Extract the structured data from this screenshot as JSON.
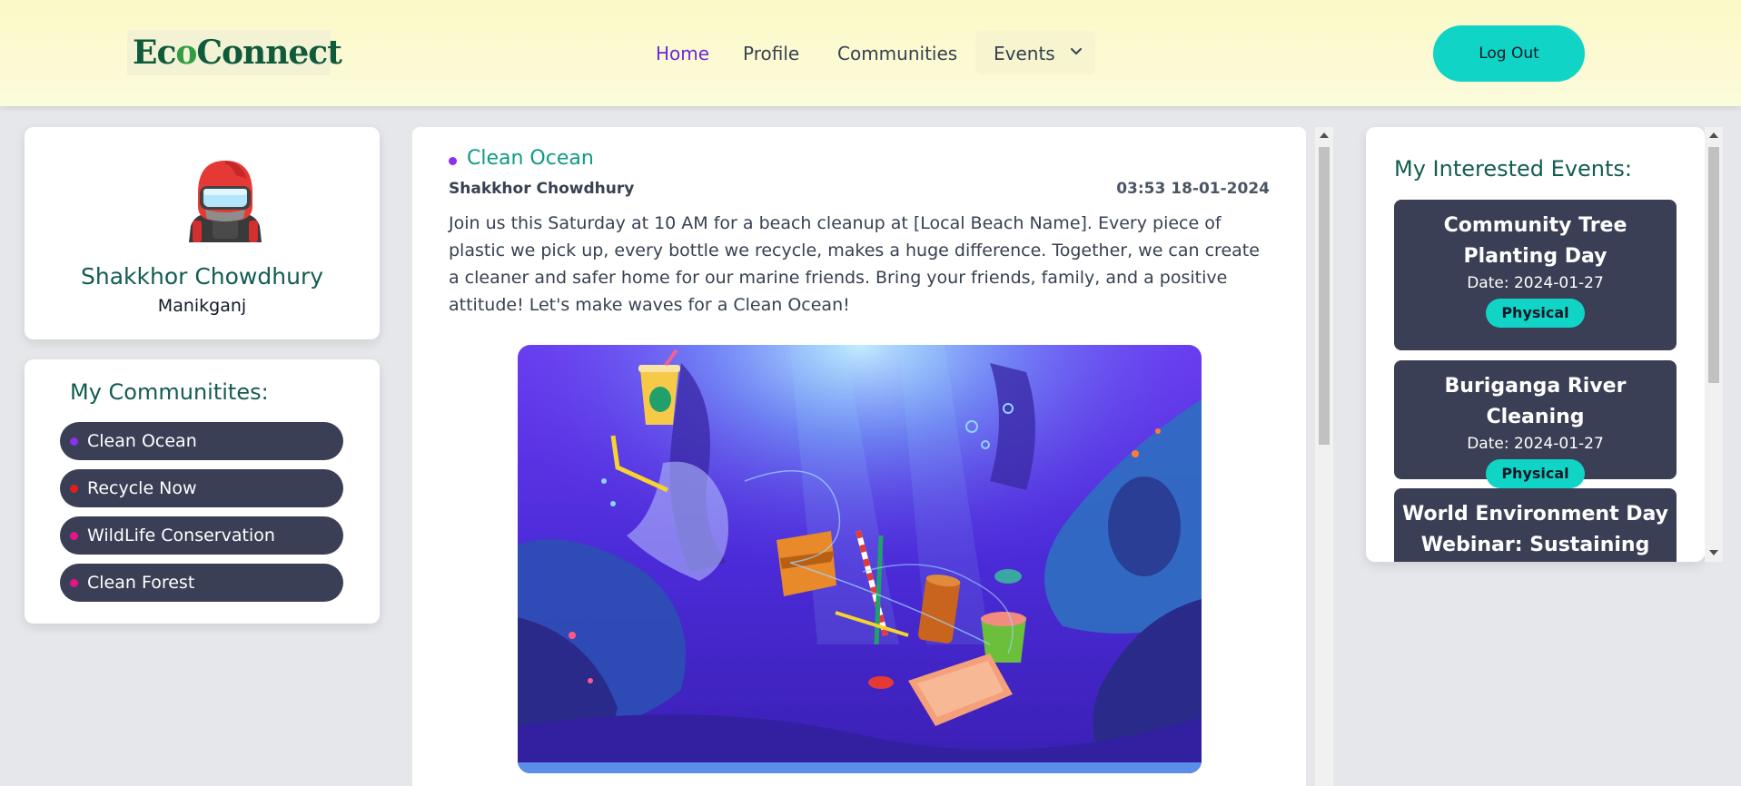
{
  "header": {
    "logo_text_pre": "Ec",
    "logo_text_leaf": "o",
    "logo_text_post": "Connect",
    "nav": [
      {
        "label": "Home",
        "active": true
      },
      {
        "label": "Profile",
        "active": false
      },
      {
        "label": "Communities",
        "active": false
      },
      {
        "label": "Events",
        "active": false
      }
    ],
    "logout_label": "Log Out"
  },
  "profile": {
    "name": "Shakkhor Chowdhury",
    "location": "Manikganj"
  },
  "communities": {
    "title": "My Communitites:",
    "items": [
      {
        "label": "Clean Ocean",
        "dot_color": "#8b2ff0"
      },
      {
        "label": "Recycle Now",
        "dot_color": "#e11d1d"
      },
      {
        "label": "WildLife Conservation",
        "dot_color": "#e6138a"
      },
      {
        "label": "Clean Forest",
        "dot_color": "#e6138a"
      }
    ]
  },
  "post": {
    "community": "Clean Ocean",
    "author": "Shakkhor Chowdhury",
    "time": "03:53 18-01-2024",
    "body": "Join us this Saturday at 10 AM for a beach cleanup at [Local Beach Name]. Every piece of plastic we pick up, every bottle we recycle, makes a huge difference. Together, we can create a cleaner and safer home for our marine friends. Bring your friends, family, and a positive attitude! Let's make waves for a Clean Ocean!"
  },
  "events": {
    "title": "My Interested Events:",
    "items": [
      {
        "name": "Community Tree Planting Day",
        "date": "Date: 2024-01-27",
        "type": "Physical"
      },
      {
        "name": "Buriganga River Cleaning",
        "date": "Date: 2024-01-27",
        "type": "Physical"
      },
      {
        "name": "World Environment Day Webinar: Sustaining Our",
        "date": "",
        "type": ""
      }
    ]
  },
  "colors": {
    "accent_teal": "#10d5c6",
    "brand_green": "#0f5a3a",
    "pill_bg": "#3a3f55",
    "active_nav": "#6d28d9"
  }
}
